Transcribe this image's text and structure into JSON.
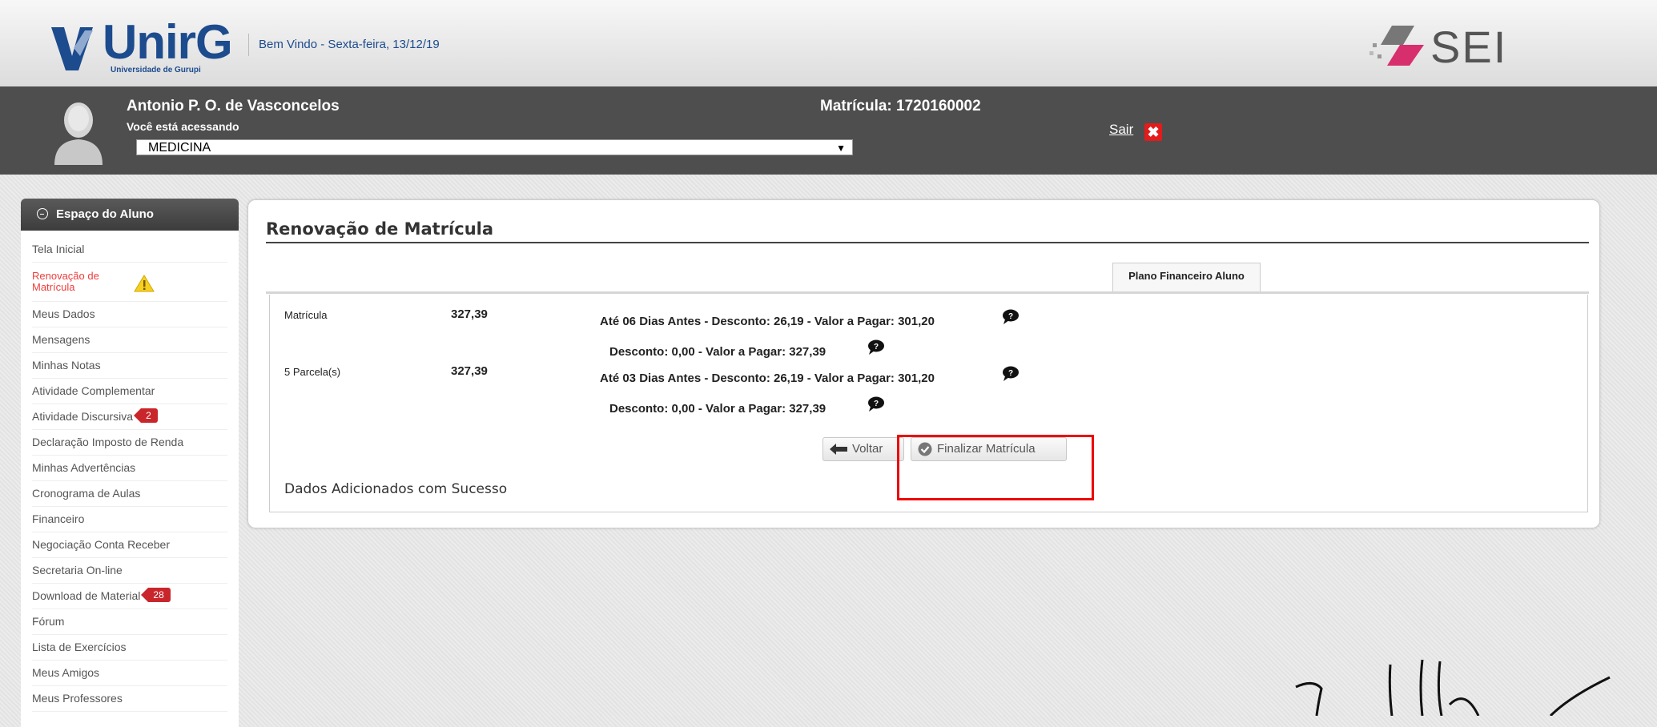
{
  "header": {
    "logo_word": "UnirG",
    "logo_sub": "Universidade de Gurupi",
    "welcome": "Bem Vindo - Sexta-feira, 13/12/19",
    "sei_word": "SEI"
  },
  "user": {
    "name": "Antonio P. O. de Vasconcelos",
    "access_label": "Você está acessando",
    "course": "MEDICINA",
    "matricula": "Matrícula: 1720160002",
    "sair": "Sair"
  },
  "sidebar": {
    "title": "Espaço do Aluno",
    "items": [
      {
        "label": "Tela Inicial"
      },
      {
        "label": "Renovação de Matrícula"
      },
      {
        "label": "Meus Dados"
      },
      {
        "label": "Mensagens"
      },
      {
        "label": "Minhas Notas"
      },
      {
        "label": "Atividade Complementar"
      },
      {
        "label": "Atividade Discursiva",
        "badge": "2"
      },
      {
        "label": "Declaração Imposto de Renda"
      },
      {
        "label": "Minhas Advertências"
      },
      {
        "label": "Cronograma de Aulas"
      },
      {
        "label": "Financeiro"
      },
      {
        "label": "Negociação Conta Receber"
      },
      {
        "label": "Secretaria On-line"
      },
      {
        "label": "Download de Material",
        "badge": "28"
      },
      {
        "label": "Fórum"
      },
      {
        "label": "Lista de Exercícios"
      },
      {
        "label": "Meus Amigos"
      },
      {
        "label": "Meus Professores"
      }
    ]
  },
  "main": {
    "title": "Renovação de Matrícula",
    "tab_label": "Plano Financeiro Aluno",
    "rows": [
      {
        "label": "Matrícula",
        "value": "327,39",
        "line1": "Até 06 Dias Antes - Desconto: 26,19 - Valor a Pagar: 301,20",
        "line2": "Desconto: 0,00 - Valor a Pagar: 327,39"
      },
      {
        "label": "5 Parcela(s)",
        "value": "327,39",
        "line1": "Até 03 Dias Antes - Desconto: 26,19 - Valor a Pagar: 301,20",
        "line2": "Desconto: 0,00 - Valor a Pagar: 327,39"
      }
    ],
    "back_label": "Voltar",
    "finish_label": "Finalizar Matrícula",
    "success_msg": "Dados Adicionados com Sucesso"
  },
  "colors": {
    "brand_blue": "#1c4b8e",
    "user_bar": "#4e4e4e",
    "active_item": "#f03c3c",
    "badge": "#c9262c",
    "highlight": "#ee0000"
  }
}
